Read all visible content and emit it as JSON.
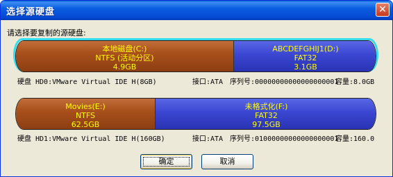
{
  "window": {
    "title": "选择源硬盘",
    "close_glyph": "✕"
  },
  "prompt": "请选择要复制的源硬盘:",
  "disks": [
    {
      "selected": true,
      "partitions": [
        {
          "name": "本地磁盘(C:)",
          "fs": "NTFS (活动分区)",
          "size": "4.9GB",
          "color": "brown"
        },
        {
          "name": "ABCDEFGHIJ1(D:)",
          "fs": "FAT32",
          "size": "3.1GB",
          "color": "blue"
        }
      ],
      "info": {
        "disk": "硬盘 HD0:VMware Virtual IDE H(8GB)",
        "interface": "接口:ATA",
        "serial": "序列号:00000000000000000001",
        "capacity": "容量:8.0GB"
      }
    },
    {
      "selected": false,
      "partitions": [
        {
          "name": "Movies(E:)",
          "fs": "NTFS",
          "size": "62.5GB",
          "color": "brown"
        },
        {
          "name": "未格式化(F:)",
          "fs": "FAT32",
          "size": "97.5GB",
          "color": "blue"
        }
      ],
      "info": {
        "disk": "硬盘 HD1:VMware Virtual IDE H(160GB)",
        "interface": "接口:ATA",
        "serial": "序列号:01000000000000000001",
        "capacity": "容量:160.0"
      }
    }
  ],
  "buttons": {
    "ok": "确定",
    "cancel": "取消"
  },
  "colors": {
    "title_bar": "#0b5ee0",
    "partition_brown": "#a9501c",
    "partition_blue": "#3b46d1",
    "partition_text": "#ffff00",
    "selection_frame": "#33ddee"
  }
}
